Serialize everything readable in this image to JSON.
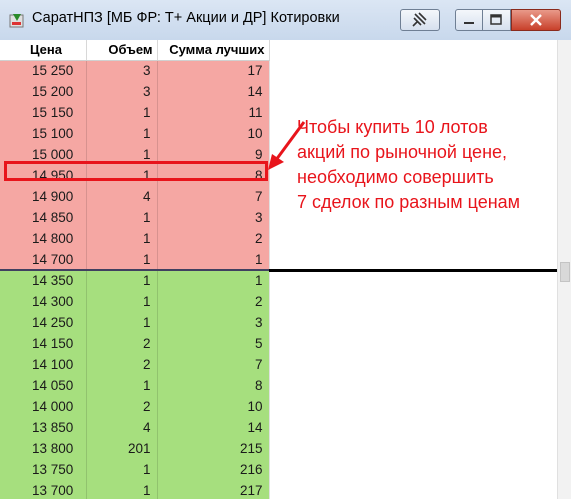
{
  "window": {
    "title": "СаратНПЗ [МБ ФР: Т+ Акции и ДР] Котировки",
    "buttons": {
      "pin": "pin-icon",
      "minimize": "minimize-icon",
      "maximize": "maximize-icon",
      "close": "close-icon"
    }
  },
  "table": {
    "headers": {
      "price": "Цена",
      "volume": "Объем",
      "sum": "Сумма лучших"
    },
    "sell_rows": [
      {
        "price": "15 250",
        "volume": "3",
        "sum": "17"
      },
      {
        "price": "15 200",
        "volume": "3",
        "sum": "14"
      },
      {
        "price": "15 150",
        "volume": "1",
        "sum": "11"
      },
      {
        "price": "15 100",
        "volume": "1",
        "sum": "10"
      },
      {
        "price": "15 000",
        "volume": "1",
        "sum": "9"
      },
      {
        "price": "14 950",
        "volume": "1",
        "sum": "8"
      },
      {
        "price": "14 900",
        "volume": "4",
        "sum": "7"
      },
      {
        "price": "14 850",
        "volume": "1",
        "sum": "3"
      },
      {
        "price": "14 800",
        "volume": "1",
        "sum": "2"
      },
      {
        "price": "14 700",
        "volume": "1",
        "sum": "1"
      }
    ],
    "buy_rows": [
      {
        "price": "14 350",
        "volume": "1",
        "sum": "1"
      },
      {
        "price": "14 300",
        "volume": "1",
        "sum": "2"
      },
      {
        "price": "14 250",
        "volume": "1",
        "sum": "3"
      },
      {
        "price": "14 150",
        "volume": "2",
        "sum": "5"
      },
      {
        "price": "14 100",
        "volume": "2",
        "sum": "7"
      },
      {
        "price": "14 050",
        "volume": "1",
        "sum": "8"
      },
      {
        "price": "14 000",
        "volume": "2",
        "sum": "10"
      },
      {
        "price": "13 850",
        "volume": "4",
        "sum": "14"
      },
      {
        "price": "13 800",
        "volume": "201",
        "sum": "215"
      },
      {
        "price": "13 750",
        "volume": "1",
        "sum": "216"
      },
      {
        "price": "13 700",
        "volume": "1",
        "sum": "217"
      }
    ]
  },
  "annotation": {
    "lines": [
      "Чтобы купить 10 лотов",
      "акций по рыночной цене,",
      "необходимо совершить",
      "7 сделок по разным ценам"
    ]
  },
  "colors": {
    "sell": "#f5a7a3",
    "buy": "#a6df7e",
    "annotation": "#e8141b"
  }
}
